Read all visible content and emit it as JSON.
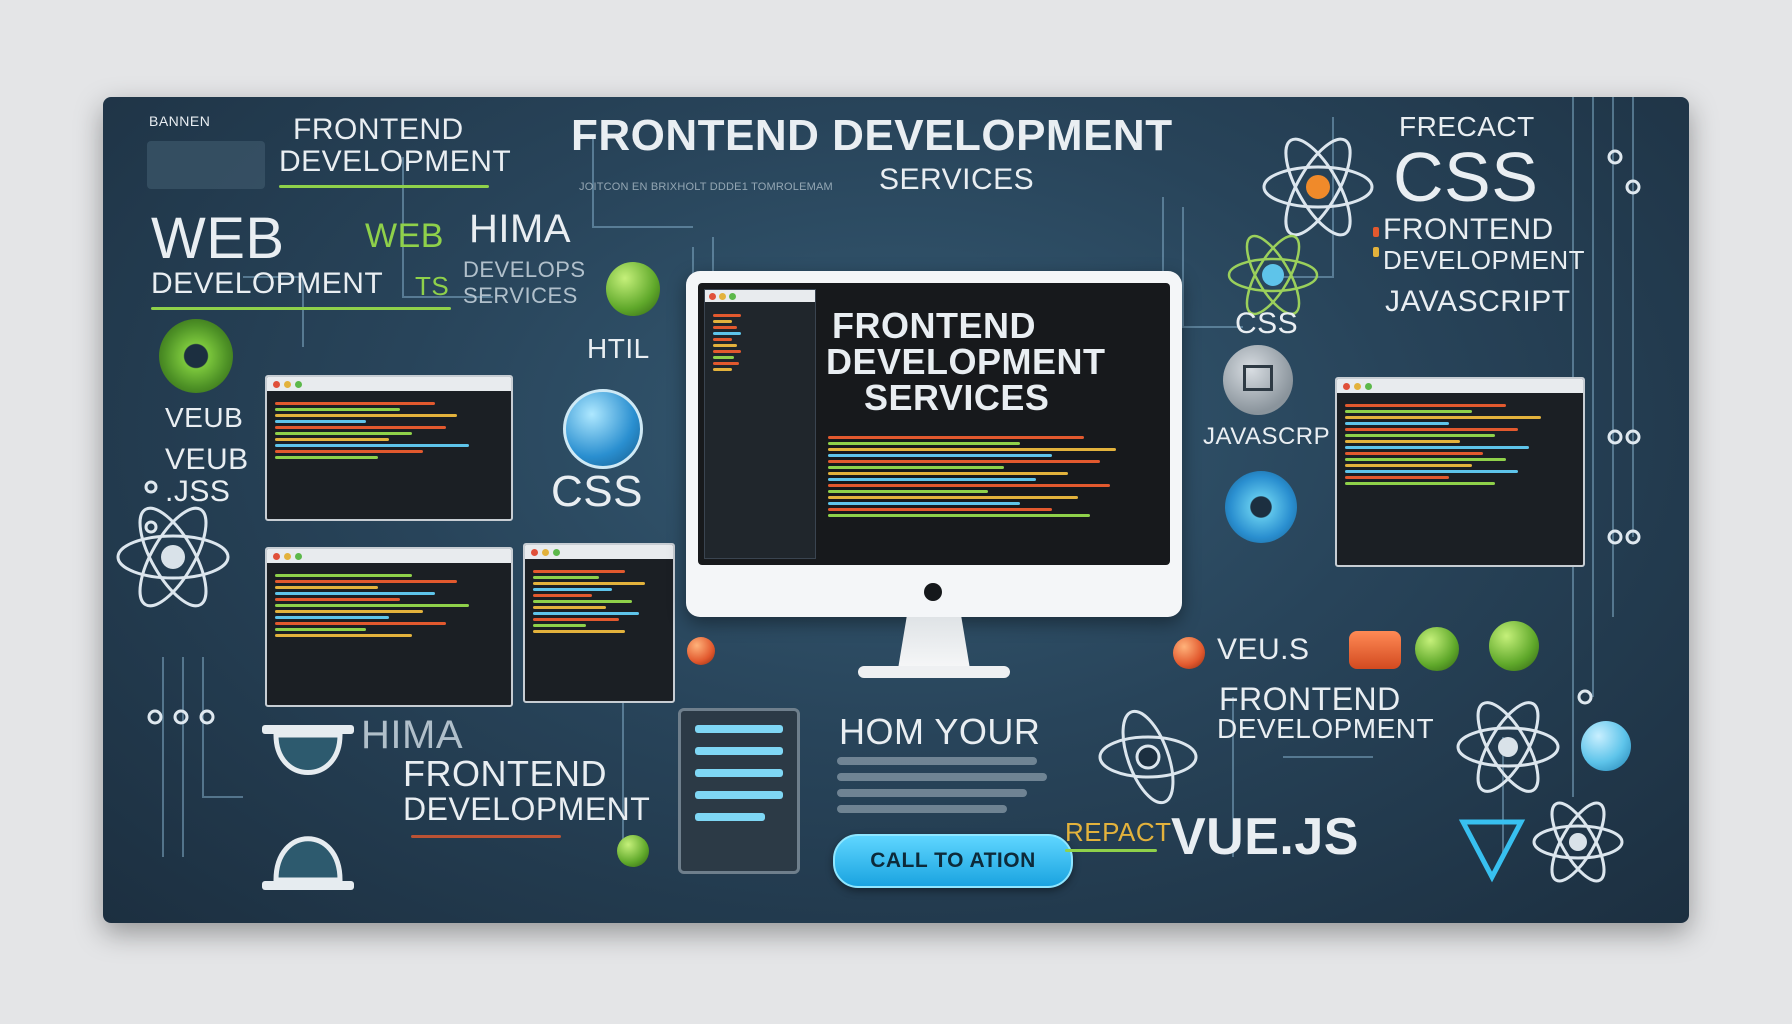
{
  "banner": {
    "corner_label": "BANNEN",
    "headline_line1": "FRONTEND DEVELOPMENT",
    "headline_line2": "SERVICES",
    "headline_caption": "JOITCON EN BRIXHOLT DDDE1 TOMROLEMAM",
    "top_left_title_line1": "FRONTEND",
    "top_left_title_line2": "DEVELOPMENT",
    "web_big": "WEB",
    "web_small": "WEB",
    "web_development": "DEVELOPMENT",
    "web_ts": "TS",
    "hima_top": "HIMA",
    "develops_line1": "DEVELOPS",
    "develops_line2": "SERVICES",
    "html_label": "HTIL",
    "css_left": "CSS",
    "veub": "VEUB",
    "veub_js_line1": "VEUB",
    "veub_js_line2": ".JSS",
    "monitor_title_line1": "FRONTEND",
    "monitor_title_line2": "DEVELOPMENT",
    "monitor_title_line3": "SERVICES",
    "frepact": "FRECACT",
    "css_big": "CSS",
    "right_frontend_line1": "FRONTEND",
    "right_frontend_line2": "DEVELOPMENT",
    "javascript_right": "JAVASCRIPT",
    "css_right": "CSS",
    "javascrp": "JAVASCRP",
    "veu_s": "VEU.S",
    "frontend_lower_line1": "FRONTEND",
    "frontend_lower_line2": "DEVELOPMENT",
    "hima_bottom": "HIMA",
    "frontend_bottom_line1": "FRONTEND",
    "frontend_bottom_line2": "DEVELOPMENT",
    "hom_your": "HOM  YOUR",
    "cta_label": "CALL TO ATION",
    "repact": "REPACT",
    "vuejs": "VUE.JS"
  },
  "colors": {
    "accent_green": "#8fd14a",
    "accent_blue": "#1aa3e0",
    "accent_orange": "#e2592e",
    "background_dark": "#1c2f40"
  }
}
